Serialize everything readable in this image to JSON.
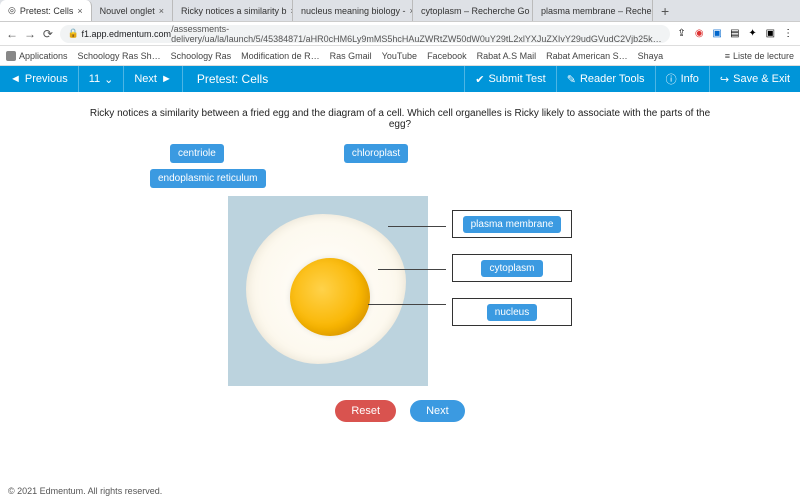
{
  "browser": {
    "tabs": [
      {
        "title": "Pretest: Cells",
        "active": true
      },
      {
        "title": "Nouvel onglet",
        "active": false
      },
      {
        "title": "Ricky notices a similarity b",
        "active": false
      },
      {
        "title": "nucleus meaning biology -",
        "active": false
      },
      {
        "title": "cytoplasm – Recherche Go",
        "active": false
      },
      {
        "title": "plasma membrane – Reche",
        "active": false
      }
    ],
    "url_domain": "f1.app.edmentum.com",
    "url_path": "/assessments-delivery/ua/la/launch/5/45384871/aHR0cHM6Ly9mMS5hcHAuZWRtZW50dW0uY29tL2xlYXJuZXIvY29udGVudC2Vjb25k…",
    "bookmarks": [
      "Applications",
      "Schoology Ras Sh…",
      "Schoology Ras",
      "Modification de R…",
      "Ras Gmail",
      "YouTube",
      "Facebook",
      "Rabat A.S Mail",
      "Rabat American S…",
      "Shaya"
    ],
    "reading_list": "Liste de lecture"
  },
  "appbar": {
    "previous": "Previous",
    "counter": "11",
    "next": "Next",
    "title": "Pretest: Cells",
    "submit": "Submit Test",
    "tools": "Reader Tools",
    "info": "Info",
    "save": "Save & Exit"
  },
  "question": "Ricky notices a similarity between a fried egg and the diagram of a cell. Which cell organelles is Ricky likely to associate with the parts of the egg?",
  "chips": {
    "centriole": "centriole",
    "chloroplast": "chloroplast",
    "er": "endoplasmic reticulum"
  },
  "targets": {
    "t1": "plasma membrane",
    "t2": "cytoplasm",
    "t3": "nucleus"
  },
  "buttons": {
    "reset": "Reset",
    "next": "Next"
  },
  "footer": "© 2021 Edmentum. All rights reserved."
}
